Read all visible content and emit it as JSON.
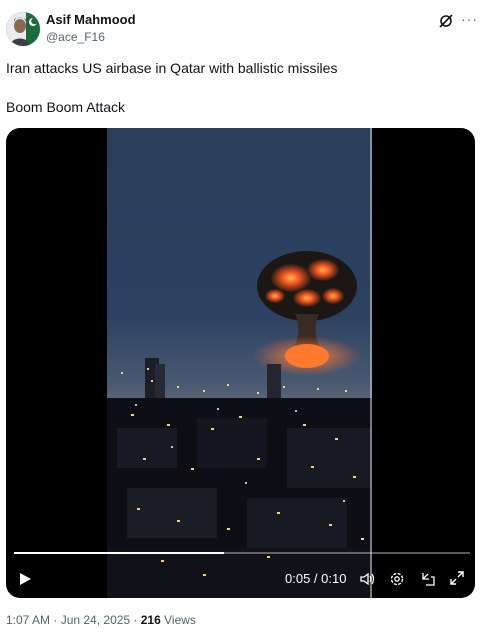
{
  "author": {
    "name": "Asif Mahmood",
    "handle": "@ace_F16",
    "avatar_icon": "avatar-pakistan-flag"
  },
  "tweet": {
    "line1": "Iran attacks US airbase in Qatar with ballistic missiles",
    "line2": "Boom Boom Attack"
  },
  "video": {
    "time": "0:05 / 0:10",
    "progress": 0.46,
    "icons": [
      "play-icon",
      "volume-icon",
      "settings-icon",
      "pip-icon",
      "fullscreen-icon"
    ]
  },
  "meta": {
    "timestamp": "1:07 AM · Jun 24, 2025 · ",
    "views_count": "216",
    "views_label": " Views"
  },
  "colors": {
    "text": "#0f1419",
    "secondary": "#536471",
    "video_bg": "#000000"
  }
}
